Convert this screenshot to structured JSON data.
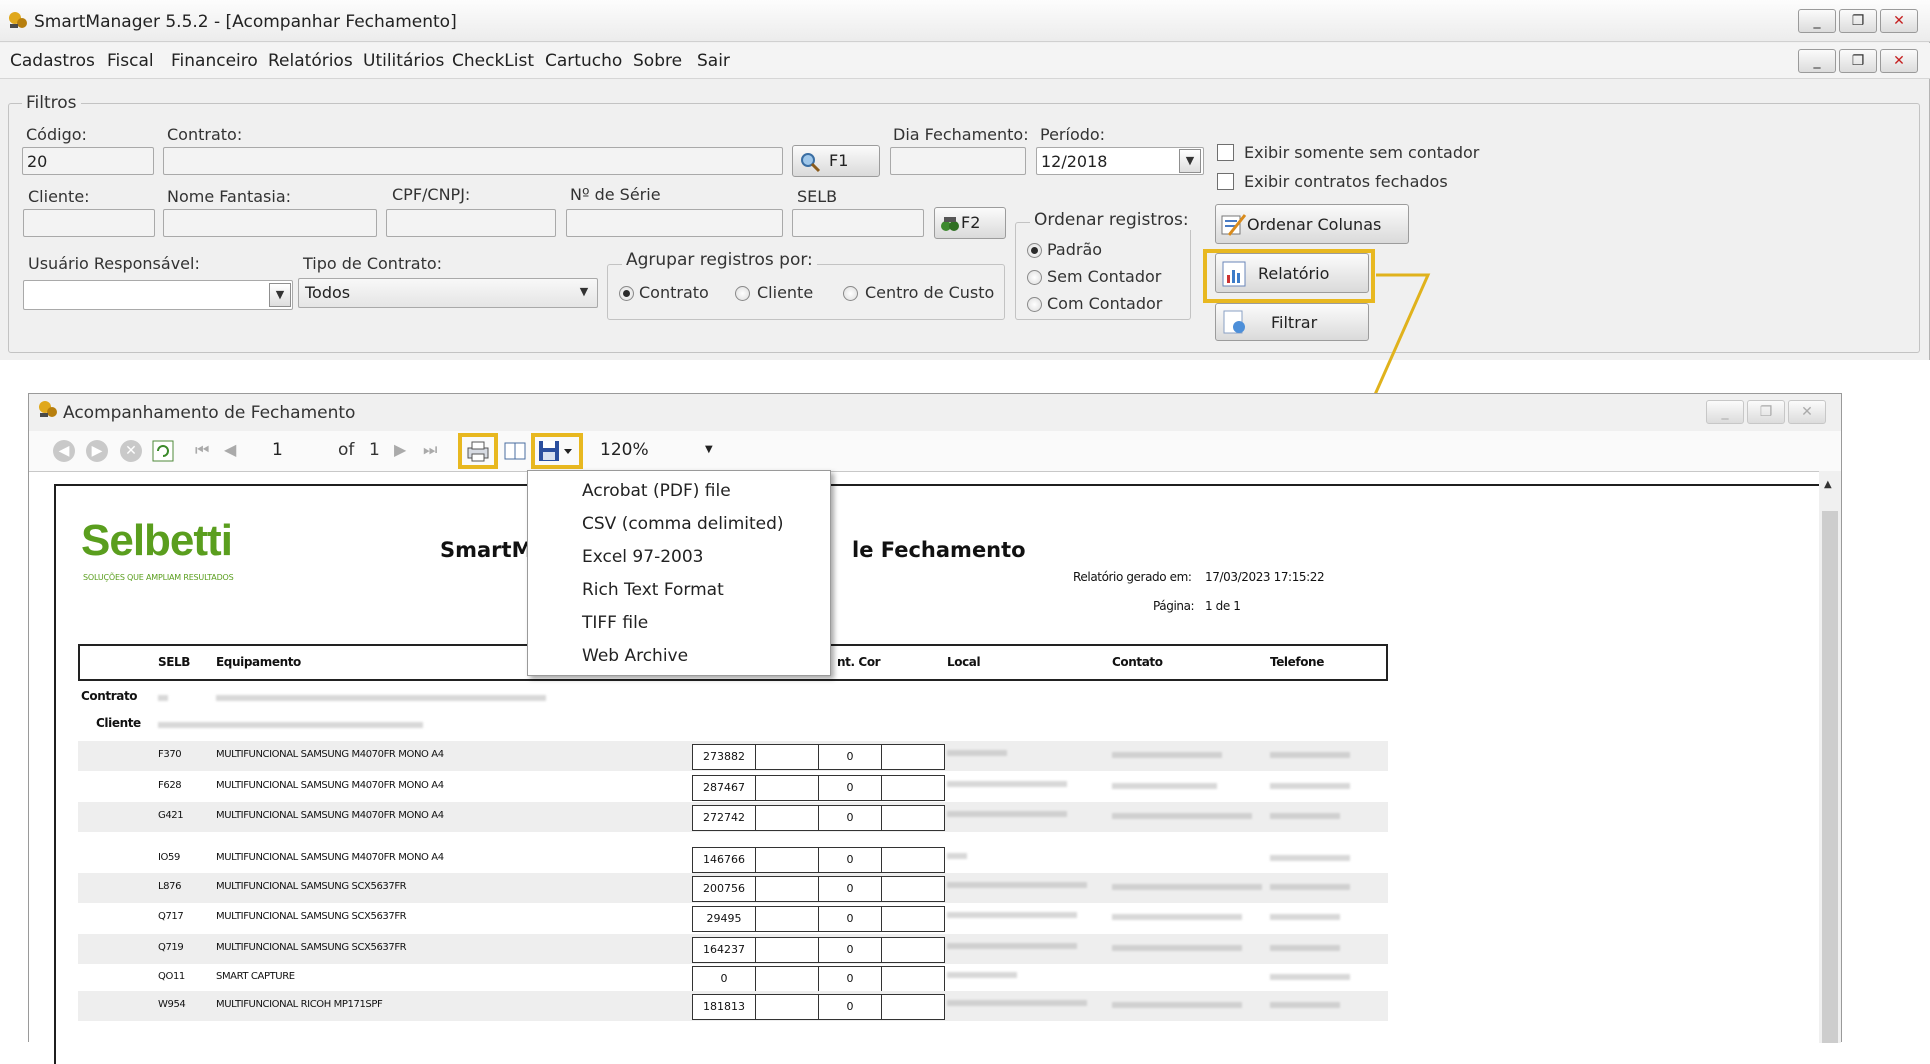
{
  "app": {
    "title": "SmartManager 5.5.2 - [Acompanhar Fechamento]",
    "window_buttons": [
      "_",
      "❐",
      "✕"
    ]
  },
  "menu": [
    "Cadastros",
    "Fiscal",
    "Financeiro",
    "Relatórios",
    "Utilitários",
    "CheckList",
    "Cartucho",
    "Sobre",
    "Sair"
  ],
  "filters": {
    "legend": "Filtros",
    "codigo_label": "Código:",
    "codigo_value": "20",
    "contrato_label": "Contrato:",
    "contrato_value": "",
    "f1_label": "F1",
    "dia_fechamento_label": "Dia Fechamento:",
    "periodo_label": "Período:",
    "periodo_value": "12/2018",
    "cliente_label": "Cliente:",
    "nome_fantasia_label": "Nome Fantasia:",
    "cpf_label": "CPF/CNPJ:",
    "serie_label": "Nº de Série",
    "selb_label": "SELB",
    "f2_label": "F2",
    "usuario_label": "Usuário Responsável:",
    "usuario_value": "",
    "tipo_label": "Tipo de Contrato:",
    "tipo_value": "Todos",
    "agrupar": {
      "legend": "Agrupar registros por:",
      "options": [
        "Contrato",
        "Cliente",
        "Centro de Custo"
      ],
      "selected": "Contrato"
    },
    "ordenar": {
      "legend": "Ordenar registros:",
      "options": [
        "Padrão",
        "Sem Contador",
        "Com Contador"
      ],
      "selected": "Padrão"
    },
    "exibir_sem_contador": "Exibir somente sem contador",
    "exibir_fechados": "Exibir contratos fechados",
    "ordenar_colunas_label": "Ordenar Colunas",
    "relatorio_label": "Relatório",
    "filtrar_label": "Filtrar"
  },
  "report_window": {
    "title": "Acompanhamento de Fechamento",
    "page_current": "1",
    "page_of": "of",
    "page_total": "1",
    "zoom": "120%"
  },
  "export_menu": [
    "Acrobat (PDF) file",
    "CSV (comma delimited)",
    "Excel 97-2003",
    "Rich Text Format",
    "TIFF file",
    "Web Archive"
  ],
  "report": {
    "logo_text": "Selbetti",
    "logo_tagline": "SOLUÇÕES QUE AMPLIAM RESULTADOS",
    "title_left": "SmartM",
    "title_right": "le Fechamento",
    "generated_label": "Relatório gerado em:",
    "generated_value": "17/03/2023 17:15:22",
    "page_label": "Página:",
    "page_value": "1 de 1",
    "columns": [
      "SELB",
      "Equipamento",
      "nt. Cor",
      "Local",
      "Contato",
      "Telefone"
    ],
    "contrato_label": "Contrato",
    "cliente_label": "Cliente",
    "rows": [
      {
        "selb": "F370",
        "equip": "MULTIFUNCIONAL SAMSUNG M4070FR MONO A4",
        "cont": "273882",
        "cor": "0"
      },
      {
        "selb": "F628",
        "equip": "MULTIFUNCIONAL SAMSUNG M4070FR MONO A4",
        "cont": "287467",
        "cor": "0"
      },
      {
        "selb": "G421",
        "equip": "MULTIFUNCIONAL SAMSUNG M4070FR MONO A4",
        "cont": "272742",
        "cor": "0"
      },
      {
        "selb": "IO59",
        "equip": "MULTIFUNCIONAL SAMSUNG M4070FR MONO A4",
        "cont": "146766",
        "cor": "0"
      },
      {
        "selb": "L876",
        "equip": "MULTIFUNCIONAL SAMSUNG SCX5637FR",
        "cont": "200756",
        "cor": "0"
      },
      {
        "selb": "Q717",
        "equip": "MULTIFUNCIONAL SAMSUNG SCX5637FR",
        "cont": "29495",
        "cor": "0"
      },
      {
        "selb": "Q719",
        "equip": "MULTIFUNCIONAL SAMSUNG SCX5637FR",
        "cont": "164237",
        "cor": "0"
      },
      {
        "selb": "QO11",
        "equip": "SMART CAPTURE",
        "cont": "0",
        "cor": "0"
      },
      {
        "selb": "W954",
        "equip": "MULTIFUNCIONAL RICOH MP171SPF",
        "cont": "181813",
        "cor": "0"
      }
    ]
  },
  "colors": {
    "highlight": "#e8b820",
    "accent_green": "#5a9e1e"
  }
}
